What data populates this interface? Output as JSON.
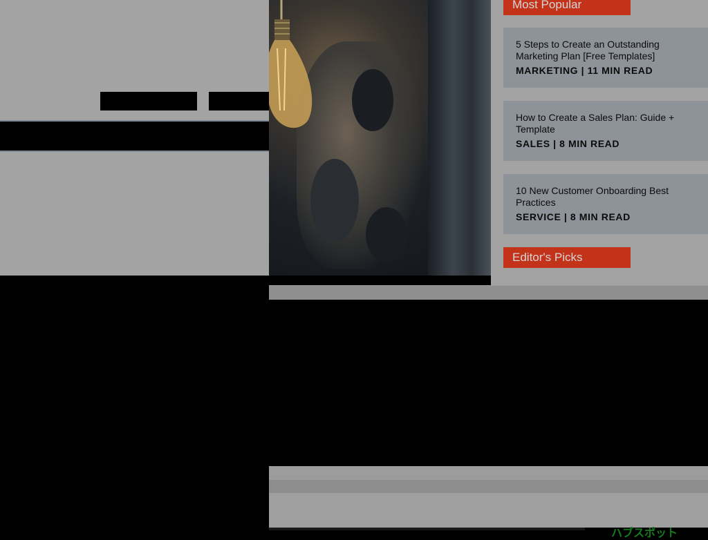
{
  "header": {
    "button_1_label": "",
    "button_2_label": ""
  },
  "sidebar": {
    "most_popular_label": "Most Popular",
    "editors_picks_label": "Editor's Picks",
    "articles": [
      {
        "title": "5 Steps to Create an Outstanding Marketing Plan [Free Templates]",
        "meta": "MARKETING | 11 MIN READ"
      },
      {
        "title": "How to Create a Sales Plan: Guide + Template",
        "meta": "SALES | 8 MIN READ"
      },
      {
        "title": "10 New Customer Onboarding Best Practices",
        "meta": "SERVICE | 8 MIN READ"
      }
    ]
  },
  "footer": {
    "logo_text": "ハブスポット"
  },
  "colors": {
    "accent": "#c2331a",
    "overlay_grey": "#a3a3a3",
    "card_bg": "#8e9399"
  }
}
